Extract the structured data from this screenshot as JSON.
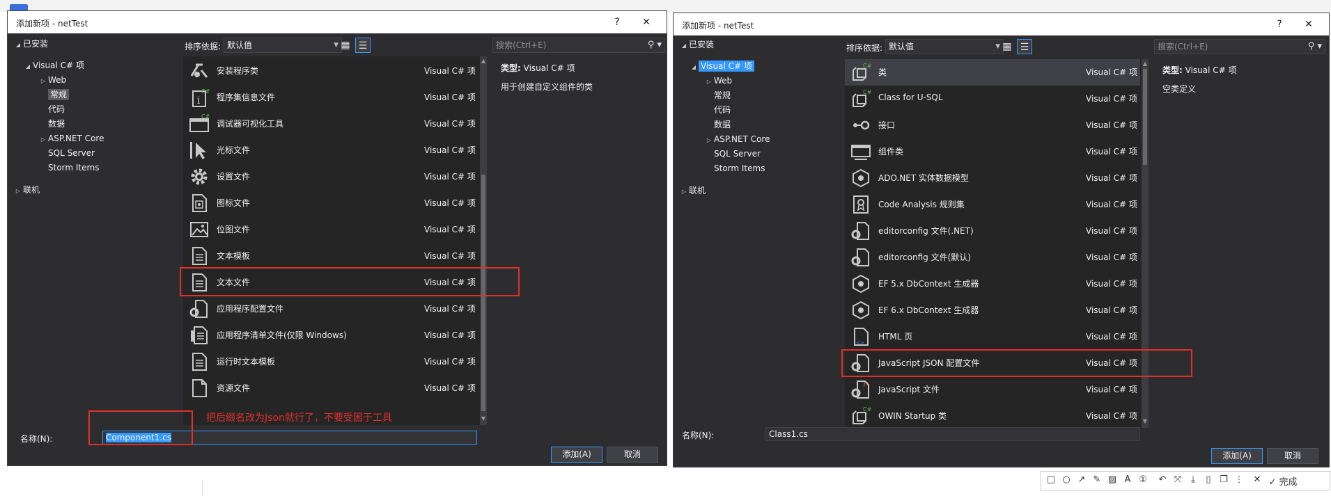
{
  "left": {
    "title": "添加新项 - netTest",
    "help": "?",
    "close": "✕",
    "tree": {
      "installed": "已安装",
      "vcsharp": "Visual C# 项",
      "web": "Web",
      "general": "常规",
      "code": "代码",
      "data": "数据",
      "aspnet": "ASP.NET Core",
      "sqlserver": "SQL Server",
      "storm": "Storm Items",
      "online": "联机"
    },
    "sort_label": "排序依据:",
    "sort_value": "默认值",
    "search_placeholder": "搜索(Ctrl+E)",
    "items": [
      {
        "name": "安装程序类",
        "type": "Visual C# 项",
        "icon": "installer-icon"
      },
      {
        "name": "程序集信息文件",
        "type": "Visual C# 项",
        "icon": "assembly-info-icon"
      },
      {
        "name": "调试器可视化工具",
        "type": "Visual C# 项",
        "icon": "debugger-visualizer-icon"
      },
      {
        "name": "光标文件",
        "type": "Visual C# 项",
        "icon": "cursor-icon"
      },
      {
        "name": "设置文件",
        "type": "Visual C# 项",
        "icon": "settings-gear-icon"
      },
      {
        "name": "图标文件",
        "type": "Visual C# 项",
        "icon": "icon-file-icon"
      },
      {
        "name": "位图文件",
        "type": "Visual C# 项",
        "icon": "bitmap-icon"
      },
      {
        "name": "文本模板",
        "type": "Visual C# 项",
        "icon": "text-template-icon"
      },
      {
        "name": "文本文件",
        "type": "Visual C# 项",
        "icon": "text-file-icon"
      },
      {
        "name": "应用程序配置文件",
        "type": "Visual C# 项",
        "icon": "config-file-icon"
      },
      {
        "name": "应用程序清单文件(仅限 Windows)",
        "type": "Visual C# 项",
        "icon": "manifest-icon"
      },
      {
        "name": "运行时文本模板",
        "type": "Visual C# 项",
        "icon": "runtime-template-icon"
      },
      {
        "name": "资源文件",
        "type": "Visual C# 项",
        "icon": "resource-file-icon"
      }
    ],
    "info_type_label": "类型:",
    "info_type_value": "Visual C# 项",
    "info_desc": "用于创建自定义组件的类",
    "name_label": "名称(N):",
    "name_value": "Component1.cs",
    "add": "添加(A)",
    "cancel": "取消",
    "annotation": "把后缀名改为Json就行了，不要受困于工具"
  },
  "right": {
    "title": "添加新项 - netTest",
    "help": "?",
    "close": "✕",
    "tree": {
      "installed": "已安装",
      "vcsharp": "Visual C# 项",
      "web": "Web",
      "general": "常规",
      "code": "代码",
      "data": "数据",
      "aspnet": "ASP.NET Core",
      "sqlserver": "SQL Server",
      "storm": "Storm Items",
      "online": "联机"
    },
    "sort_label": "排序依据:",
    "sort_value": "默认值",
    "search_placeholder": "搜索(Ctrl+E)",
    "items": [
      {
        "name": "类",
        "type": "Visual C# 项",
        "icon": "class-icon"
      },
      {
        "name": "Class for U-SQL",
        "type": "Visual C# 项",
        "icon": "usql-class-icon"
      },
      {
        "name": "接口",
        "type": "Visual C# 项",
        "icon": "interface-icon"
      },
      {
        "name": "组件类",
        "type": "Visual C# 项",
        "icon": "component-class-icon"
      },
      {
        "name": "ADO.NET 实体数据模型",
        "type": "Visual C# 项",
        "icon": "ado-net-icon"
      },
      {
        "name": "Code Analysis 规则集",
        "type": "Visual C# 项",
        "icon": "ruleset-icon"
      },
      {
        "name": "editorconfig 文件(.NET)",
        "type": "Visual C# 项",
        "icon": "editorconfig-icon"
      },
      {
        "name": "editorconfig 文件(默认)",
        "type": "Visual C# 项",
        "icon": "editorconfig-default-icon"
      },
      {
        "name": "EF 5.x DbContext 生成器",
        "type": "Visual C# 项",
        "icon": "ef5-icon"
      },
      {
        "name": "EF 6.x DbContext 生成器",
        "type": "Visual C# 项",
        "icon": "ef6-icon"
      },
      {
        "name": "HTML 页",
        "type": "Visual C# 项",
        "icon": "html-page-icon"
      },
      {
        "name": "JavaScript JSON 配置文件",
        "type": "Visual C# 项",
        "icon": "json-config-icon"
      },
      {
        "name": "JavaScript 文件",
        "type": "Visual C# 项",
        "icon": "javascript-icon"
      },
      {
        "name": "OWIN Startup 类",
        "type": "Visual C# 项",
        "icon": "owin-icon"
      }
    ],
    "info_type_label": "类型:",
    "info_type_value": "Visual C# 项",
    "info_desc": "空类定义",
    "name_label": "名称(N):",
    "name_value": "Class1.cs",
    "add": "添加(A)",
    "cancel": "取消"
  },
  "annot_toolbar": {
    "done": "完成"
  }
}
